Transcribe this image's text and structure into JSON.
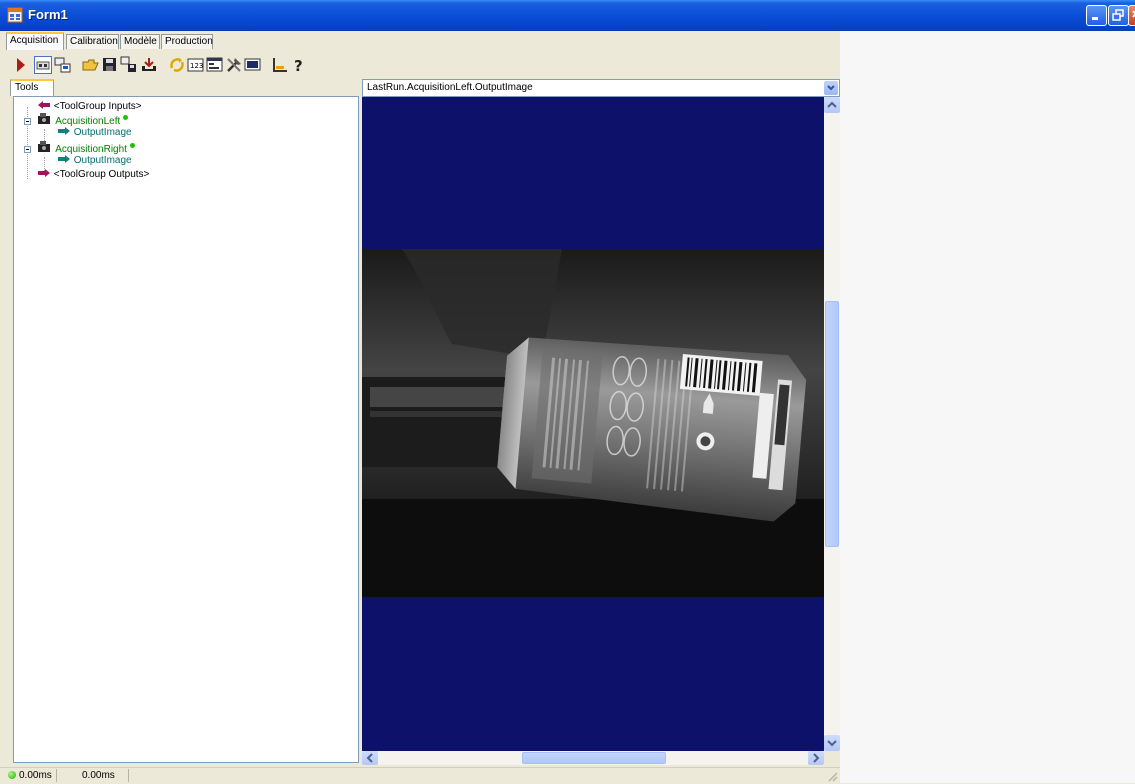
{
  "window": {
    "title": "Form1"
  },
  "tabs": [
    {
      "label": "Acquisition",
      "active": true
    },
    {
      "label": "Calibration",
      "active": false
    },
    {
      "label": "Modèle",
      "active": false
    },
    {
      "label": "Production",
      "active": false
    }
  ],
  "toolbar": {
    "icons": [
      "run-icon",
      "display-icon",
      "tool-display-icon",
      "open-icon",
      "save-icon",
      "save-all-icon",
      "import-icon",
      "refresh-icon",
      "result-table-icon",
      "options-icon",
      "tools-icon",
      "image-source-icon",
      "measure-icon",
      "help-icon"
    ]
  },
  "tools_panel": {
    "tab_label": "Tools",
    "tree": [
      {
        "label": "<ToolGroup Inputs>"
      },
      {
        "label": "AcquisitionLeft"
      },
      {
        "label": "OutputImage"
      },
      {
        "label": "AcquisitionRight"
      },
      {
        "label": "OutputImage"
      },
      {
        "label": "<ToolGroup Outputs>"
      }
    ]
  },
  "viewer": {
    "selected_image": "LastRun.AcquisitionLeft.OutputImage",
    "background_color": "#0e1169"
  },
  "status": {
    "time1": "0.00ms",
    "time2": "0.00ms"
  }
}
